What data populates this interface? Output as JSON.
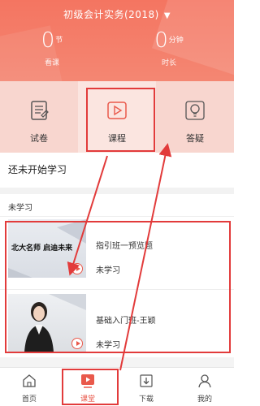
{
  "header": {
    "course_title": "初级会计实务(2018)",
    "stats": [
      {
        "value": "0",
        "unit": "节",
        "label": "看课"
      },
      {
        "value": "0",
        "unit": "分钟",
        "label": "时长"
      }
    ]
  },
  "tiles": [
    {
      "label": "试卷",
      "icon": "exam-paper-icon"
    },
    {
      "label": "课程",
      "icon": "play-course-icon"
    },
    {
      "label": "答疑",
      "icon": "lightbulb-icon"
    }
  ],
  "status_text": "还未开始学习",
  "section_title": "未学习",
  "lessons": [
    {
      "thumb_text": "北大名师 启迪未来",
      "title": "指引班一预览题",
      "status": "未学习"
    },
    {
      "title": "基础入门班-王颖",
      "status": "未学习"
    }
  ],
  "tabbar": [
    {
      "label": "首页",
      "icon": "home-icon",
      "active": false
    },
    {
      "label": "课堂",
      "icon": "classroom-icon",
      "active": true
    },
    {
      "label": "下载",
      "icon": "download-icon",
      "active": false
    },
    {
      "label": "我的",
      "icon": "profile-icon",
      "active": false
    }
  ],
  "colors": {
    "accent": "#e9594b",
    "header": "#f47561",
    "annotation": "#e23b3b"
  }
}
